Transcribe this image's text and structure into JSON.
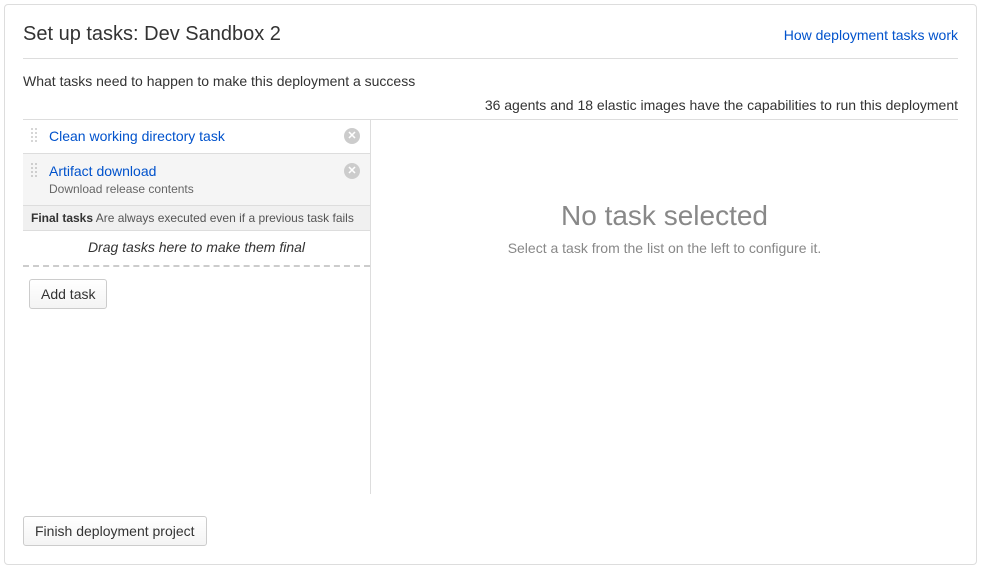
{
  "header": {
    "title": "Set up tasks: Dev Sandbox 2",
    "help_link": "How deployment tasks work"
  },
  "subtitle": "What tasks need to happen to make this deployment a success",
  "capabilities": {
    "agents_count": 36,
    "elastic_images_count": 18,
    "text_full": "36 agents and 18 elastic images have the capabilities to run this deployment"
  },
  "tasks": [
    {
      "title": "Clean working directory task",
      "description": ""
    },
    {
      "title": "Artifact download",
      "description": "Download release contents"
    }
  ],
  "final_tasks": {
    "label": "Final tasks",
    "note": "Are always executed even if a previous task fails",
    "drop_hint": "Drag tasks here to make them final"
  },
  "buttons": {
    "add_task": "Add task",
    "finish": "Finish deployment project"
  },
  "detail": {
    "empty_title": "No task selected",
    "empty_subtitle": "Select a task from the list on the left to configure it."
  }
}
